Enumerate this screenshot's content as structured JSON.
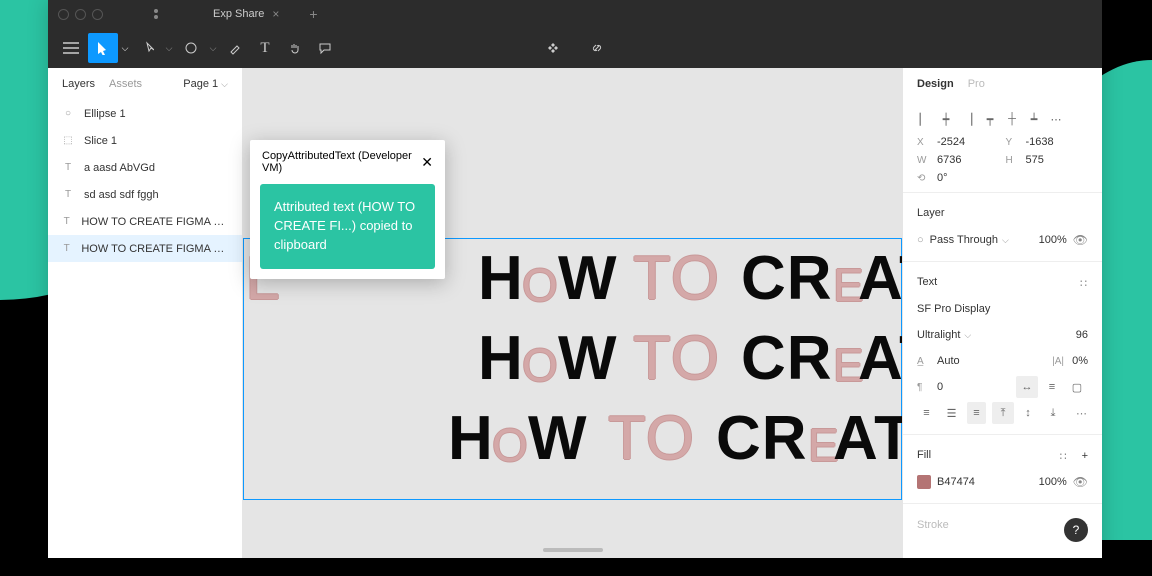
{
  "titlebar": {
    "tab": "Exp Share"
  },
  "leftPanel": {
    "tabs": {
      "layers": "Layers",
      "assets": "Assets",
      "page": "Page 1"
    },
    "layers": [
      {
        "icon": "circle",
        "label": "Ellipse 1"
      },
      {
        "icon": "slice",
        "label": "Slice 1"
      },
      {
        "icon": "text",
        "label": "a aasd AbVGd"
      },
      {
        "icon": "text",
        "label": "sd asd sdf fggh"
      },
      {
        "icon": "text",
        "label": "HOW TO CREATE FIGMA PLUGIN?..."
      },
      {
        "icon": "text",
        "label": "HOW TO CREATE FIGMA PLUGIN?..."
      }
    ]
  },
  "popup": {
    "title": "CopyAttributedText (Developer VM)",
    "toast": "Attributed text (HOW TO CREATE FI...) copied to clipboard"
  },
  "design": {
    "tab1": "Design",
    "tab2": "Pro",
    "x": "-2524",
    "y": "-1638",
    "w": "6736",
    "h": "575",
    "rot": "0°",
    "layerTitle": "Layer",
    "blend": "Pass Through",
    "opacity": "100%",
    "textTitle": "Text",
    "font": "SF Pro Display",
    "weight": "Ultralight",
    "size": "96",
    "lineHeight": "Auto",
    "letter": "0%",
    "para": "0",
    "fillTitle": "Fill",
    "fillHex": "B47474",
    "fillOpacity": "100%",
    "strokeTitle": "Stroke"
  }
}
